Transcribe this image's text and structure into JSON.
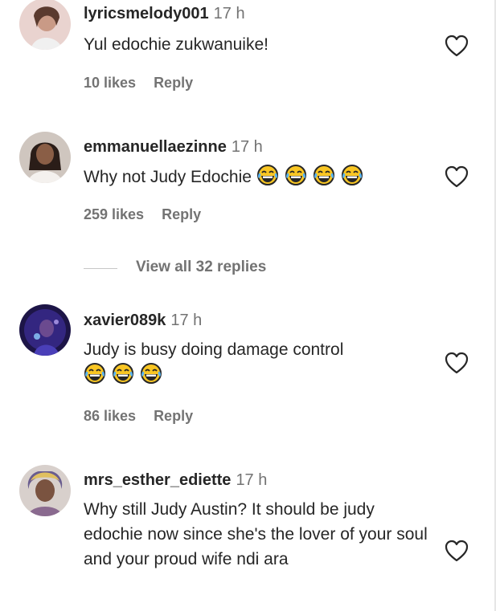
{
  "comments": [
    {
      "username": "lyricsmelody001",
      "time": "17 h",
      "text": "Yul edochie zukwanuike!",
      "likes": "10 likes",
      "reply": "Reply",
      "avatar_color": "#d9b8b0"
    },
    {
      "username": "emmanuellaezinne",
      "time": "17 h",
      "text": "Why not Judy Edochie",
      "emoji_count": 4,
      "emoji_icon": "face-with-tears-of-joy-icon",
      "likes": "259 likes",
      "reply": "Reply",
      "avatar_color": "#7a5a48"
    },
    {
      "username": "xavier089k",
      "time": "17 h",
      "text": "Judy is busy doing damage control",
      "emoji_count": 3,
      "emoji_icon": "face-with-tears-of-joy-icon",
      "likes": "86 likes",
      "reply": "Reply",
      "avatar_color": "#2b1d6b"
    },
    {
      "username": "mrs_esther_ediette",
      "time": "17 h",
      "text": "Why still Judy Austin? It should be judy edochie now since she's the lover of your soul and your proud wife ndi ara",
      "avatar_color": "#6e5a4e"
    }
  ],
  "view_replies": "View all 32 replies",
  "like_icon": "heart-outline-icon",
  "colors": {
    "text": "#262626",
    "secondary": "#737373",
    "emoji_face": "#f9c623"
  }
}
